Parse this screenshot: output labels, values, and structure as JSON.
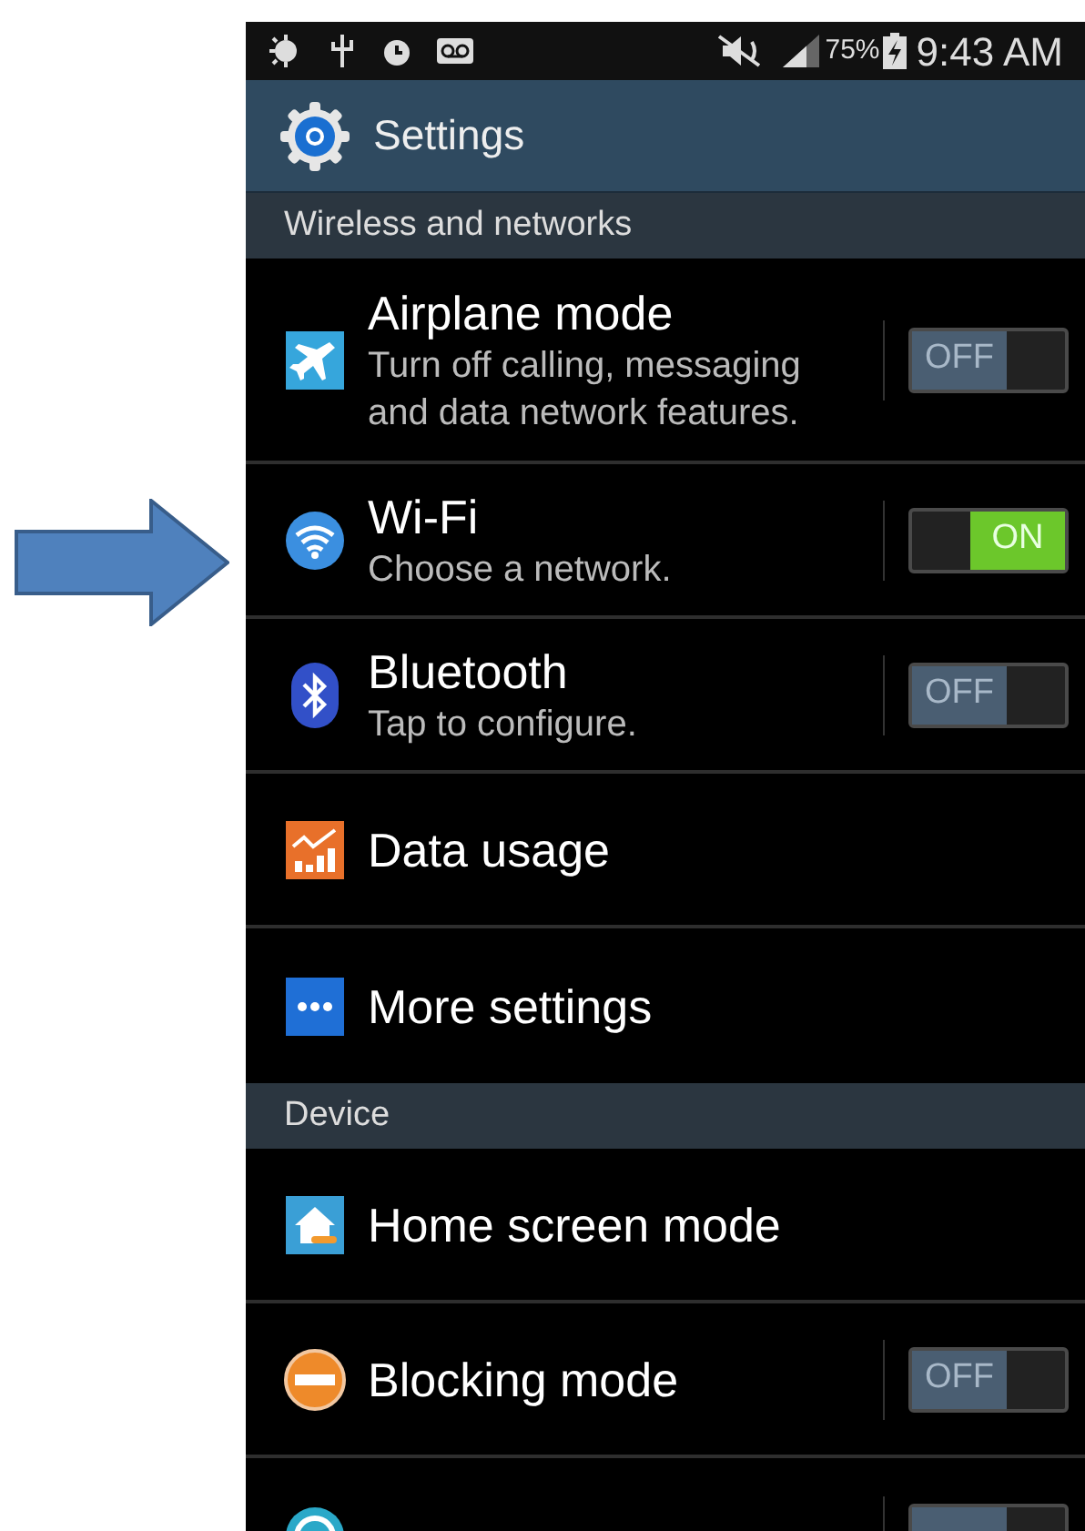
{
  "status_bar": {
    "battery": "75%",
    "time": "9:43 AM"
  },
  "header": {
    "title": "Settings"
  },
  "sections": [
    {
      "title": "Wireless and networks",
      "items": [
        {
          "kind": "toggle",
          "title": "Airplane mode",
          "subtitle": "Turn off calling, messaging and data network features.",
          "switch": {
            "on": false,
            "label": "OFF"
          }
        },
        {
          "kind": "toggle",
          "title": "Wi-Fi",
          "subtitle": "Choose a network.",
          "switch": {
            "on": true,
            "label": "ON"
          }
        },
        {
          "kind": "toggle",
          "title": "Bluetooth",
          "subtitle": "Tap to configure.",
          "switch": {
            "on": false,
            "label": "OFF"
          }
        },
        {
          "kind": "link",
          "title": "Data usage"
        },
        {
          "kind": "link",
          "title": "More settings"
        }
      ]
    },
    {
      "title": "Device",
      "items": [
        {
          "kind": "link",
          "title": "Home screen mode"
        },
        {
          "kind": "toggle",
          "title": "Blocking mode",
          "switch": {
            "on": false,
            "label": "OFF"
          }
        },
        {
          "kind": "toggle",
          "switch": {
            "on": false
          }
        }
      ]
    }
  ]
}
